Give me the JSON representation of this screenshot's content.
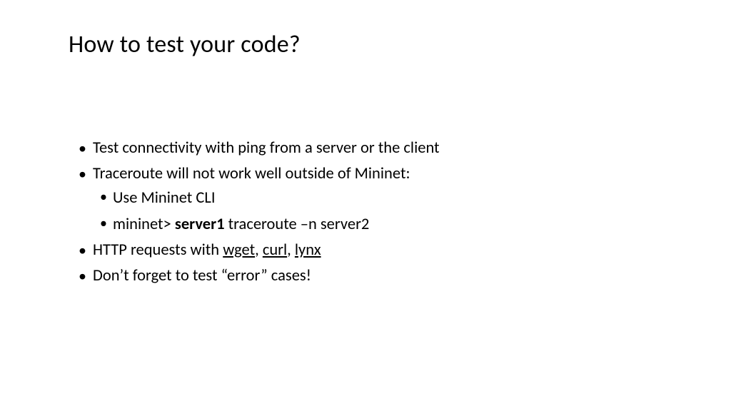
{
  "title": "How to test your code?",
  "bullets": {
    "b1": "Test connectivity with ping from a server or the client",
    "b2": "Traceroute will not work well outside of Mininet:",
    "b2_sub": {
      "s1": "Use Mininet CLI",
      "s2_pre": "mininet> ",
      "s2_bold": "server1",
      "s2_post": " traceroute –n server2"
    },
    "b3_pre": "HTTP requests with ",
    "b3_u1": "wget",
    "b3_sep1": ", ",
    "b3_u2": "curl",
    "b3_sep2": ", ",
    "b3_u3": "lynx",
    "b4": "Don’t forget to test “error” cases!"
  }
}
